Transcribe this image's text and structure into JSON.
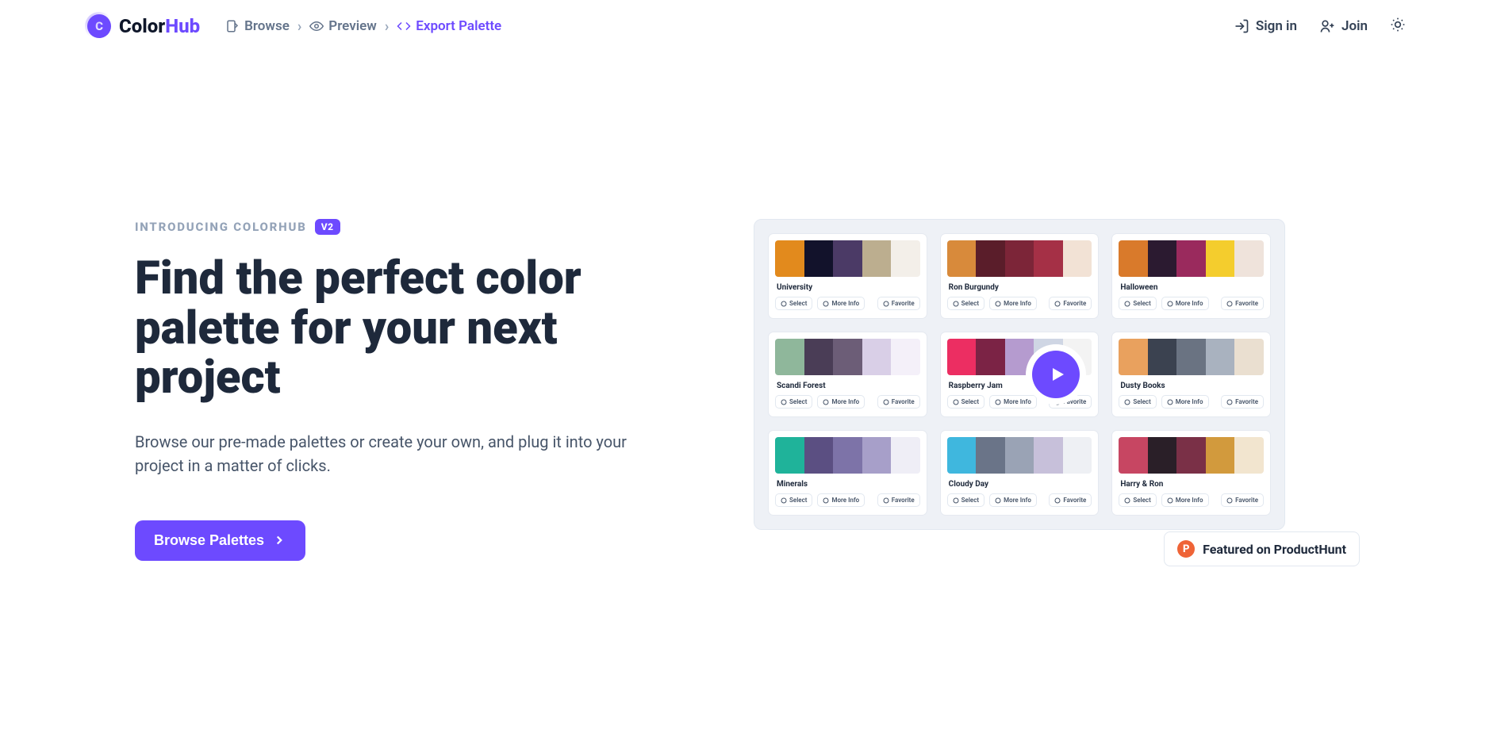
{
  "brand": {
    "name1": "Color",
    "name2": "Hub",
    "mark": "C"
  },
  "nav": {
    "browse": "Browse",
    "preview": "Preview",
    "export": "Export Palette"
  },
  "auth": {
    "signin": "Sign in",
    "join": "Join"
  },
  "hero": {
    "eyebrow": "INTRODUCING COLORHUB",
    "badge": "V2",
    "headline": "Find the perfect color palette for your next project",
    "subcopy": "Browse our pre-made palettes or create your own, and plug it into your project in a matter of clicks.",
    "cta": "Browse Palettes"
  },
  "actions": {
    "select": "Select",
    "more": "More Info",
    "favorite": "Favorite"
  },
  "palettes": [
    {
      "name": "University",
      "colors": [
        "#e28a1d",
        "#12122b",
        "#4b3a66",
        "#bcae8f",
        "#f3efe9"
      ]
    },
    {
      "name": "Ron Burgundy",
      "colors": [
        "#d88a3b",
        "#5a1d2a",
        "#7c2538",
        "#a53046",
        "#f2e2d5"
      ]
    },
    {
      "name": "Halloween",
      "colors": [
        "#d97a2b",
        "#2b1a30",
        "#9a2a5d",
        "#f4cd2d",
        "#efe3db"
      ]
    },
    {
      "name": "Scandi Forest",
      "colors": [
        "#8fb79b",
        "#4a3d56",
        "#6c5d77",
        "#d9cfe7",
        "#f4f0f9"
      ]
    },
    {
      "name": "Raspberry Jam",
      "colors": [
        "#ec2e62",
        "#7b2345",
        "#b59bcf",
        "#cfd6e4",
        "#f3f3f3"
      ]
    },
    {
      "name": "Dusty Books",
      "colors": [
        "#e9a15e",
        "#3b4250",
        "#6a7382",
        "#a9b2bf",
        "#eadfd0"
      ]
    },
    {
      "name": "Minerals",
      "colors": [
        "#1fb39a",
        "#5b4f82",
        "#7d73a8",
        "#a79fc9",
        "#efeef6"
      ]
    },
    {
      "name": "Cloudy Day",
      "colors": [
        "#3fb7de",
        "#6a7488",
        "#9aa3b5",
        "#c7c0da",
        "#eef0f4"
      ]
    },
    {
      "name": "Harry & Ron",
      "colors": [
        "#c74662",
        "#2a1f28",
        "#7a3047",
        "#d29a3d",
        "#f2e5cf"
      ]
    }
  ],
  "ph": {
    "label": "Featured on ProductHunt",
    "mark": "P"
  }
}
